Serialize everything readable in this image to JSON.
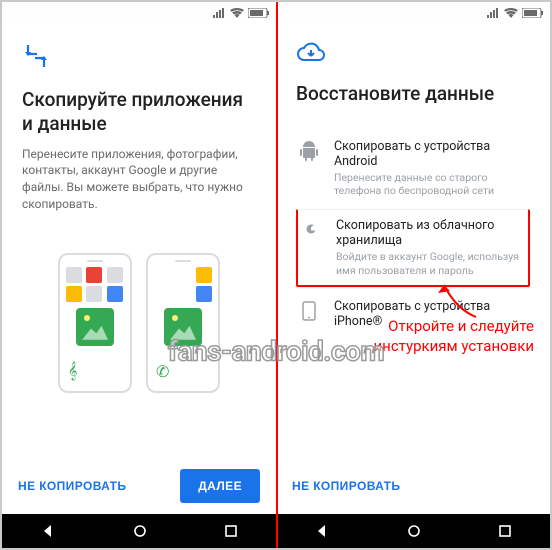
{
  "left": {
    "title": "Скопируйте приложения и данные",
    "desc": "Перенесите приложения, фотографии, контакты, аккаунт Google и другие файлы. Вы можете выбрать, что нужно скопировать.",
    "btn_skip": "НЕ КОПИРОВАТЬ",
    "btn_next": "ДАЛЕЕ"
  },
  "right": {
    "title": "Восстановите данные",
    "options": [
      {
        "title": "Скопировать с устройства Android",
        "sub": "Перенесите данные со старого телефона по беспроводной сети"
      },
      {
        "title": "Скопировать из облачного хранилища",
        "sub": "Войдите в аккаунт Google, используя имя пользователя и пароль"
      },
      {
        "title": "Скопировать с устройства iPhone®",
        "sub": ""
      }
    ],
    "btn_skip": "НЕ КОПИРОВАТЬ"
  },
  "annotation": {
    "line1": "Откройте и следуйте",
    "line2": "инстуркиям установки"
  },
  "watermark": "fans-android.com"
}
